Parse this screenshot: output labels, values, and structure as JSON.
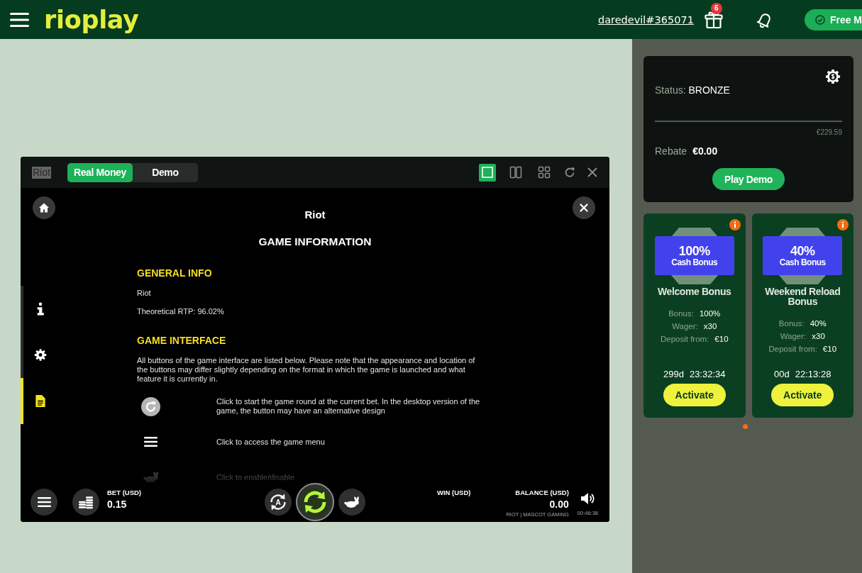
{
  "header": {
    "logo": "rioplay",
    "username": "daredevil#365071",
    "gift_count": "6",
    "free_button": "Free M"
  },
  "game_window": {
    "title": "Riot",
    "mode_tabs": [
      {
        "label": "Real Money",
        "selected": true
      },
      {
        "label": "Demo",
        "selected": false
      }
    ],
    "layouts": [
      {
        "kind": "single",
        "selected": true
      },
      {
        "kind": "split",
        "selected": false
      },
      {
        "kind": "grid",
        "selected": false
      }
    ]
  },
  "game_info": {
    "title": "Riot",
    "heading": "GAME INFORMATION",
    "nav": [
      {
        "kind": "info",
        "selected": false
      },
      {
        "kind": "settings",
        "selected": false
      },
      {
        "kind": "rules",
        "selected": true
      }
    ],
    "sections": [
      {
        "heading": "GENERAL INFO",
        "paragraphs": [
          "Riot",
          "Theoretical RTP: 96.02%"
        ]
      },
      {
        "heading": "GAME INTERFACE",
        "paragraphs": [
          "All buttons of the game interface are listed below. Please note that the appearance and location of the buttons may differ slightly depending on the format in which the game is launched and what feature it is currently in."
        ]
      }
    ],
    "button_help": [
      {
        "kind": "spin",
        "text": "Click to start the game round at the current bet. In the desktop version of the game, the button may have an alternative design"
      },
      {
        "kind": "menu",
        "text": "Click to access the game menu"
      },
      {
        "kind": "turbo",
        "text": "Click to enable/disable"
      }
    ]
  },
  "game_bar": {
    "autoplay_letter": "A",
    "bet_label": "BET (USD)",
    "bet_value": "0.15",
    "win_label": "WIN (USD)",
    "balance_label": "BALANCE (USD)",
    "balance_value": "0.00",
    "provider": "RIOT | MASCOT GAMING",
    "clock": "00:46:38"
  },
  "status_card": {
    "label": "Status:",
    "value": "BRONZE",
    "target": "€229.59",
    "rebate_label": "Rebate",
    "rebate_value": "€0.00",
    "button": "Play Demo"
  },
  "bonuses": [
    {
      "percent": "100%",
      "type": "Cash Bonus",
      "title": "Welcome Bonus",
      "details": [
        {
          "label": "Bonus:",
          "value": "100%"
        },
        {
          "label": "Wager:",
          "value": "x30"
        },
        {
          "label": "Deposit from:",
          "value": "€10"
        }
      ],
      "timer_days": "299d",
      "timer_time": "23:32:34",
      "button": "Activate"
    },
    {
      "percent": "40%",
      "type": "Cash Bonus",
      "title": "Weekend Reload Bonus",
      "details": [
        {
          "label": "Bonus:",
          "value": "40%"
        },
        {
          "label": "Wager:",
          "value": "x30"
        },
        {
          "label": "Deposit from:",
          "value": "€10"
        }
      ],
      "timer_days": "00d",
      "timer_time": "22:13:28",
      "button": "Activate"
    }
  ],
  "pagination": [
    {
      "selected": true
    }
  ]
}
